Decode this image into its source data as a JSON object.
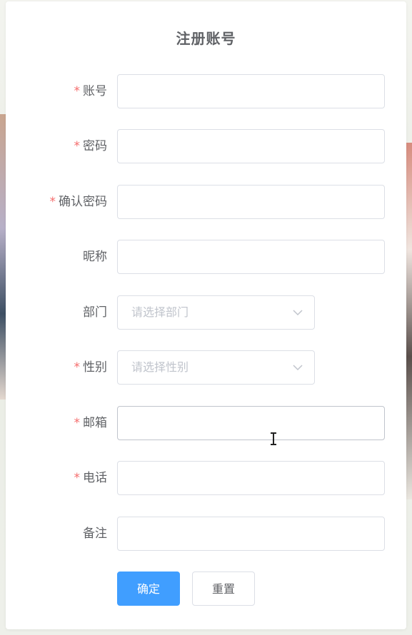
{
  "form": {
    "title": "注册账号",
    "fields": [
      {
        "label": "账号",
        "required": true,
        "type": "input",
        "value": ""
      },
      {
        "label": "密码",
        "required": true,
        "type": "input",
        "value": ""
      },
      {
        "label": "确认密码",
        "required": true,
        "type": "input",
        "value": ""
      },
      {
        "label": "昵称",
        "required": false,
        "type": "input",
        "value": ""
      },
      {
        "label": "部门",
        "required": false,
        "type": "select",
        "placeholder": "请选择部门"
      },
      {
        "label": "性别",
        "required": true,
        "type": "select",
        "placeholder": "请选择性别"
      },
      {
        "label": "邮箱",
        "required": true,
        "type": "input",
        "value": "",
        "focused": true
      },
      {
        "label": "电话",
        "required": true,
        "type": "input",
        "value": ""
      },
      {
        "label": "备注",
        "required": false,
        "type": "input",
        "value": ""
      }
    ],
    "required_mark": "*",
    "buttons": {
      "confirm": "确定",
      "reset": "重置"
    }
  },
  "icons": {
    "select_arrow": "chevron-down-icon",
    "mouse_cursor": "text-cursor-icon"
  },
  "colors": {
    "primary": "#409eff",
    "required": "#f56c6c",
    "label": "#606266",
    "placeholder": "#c0c4cc",
    "border": "#dcdfe6"
  }
}
